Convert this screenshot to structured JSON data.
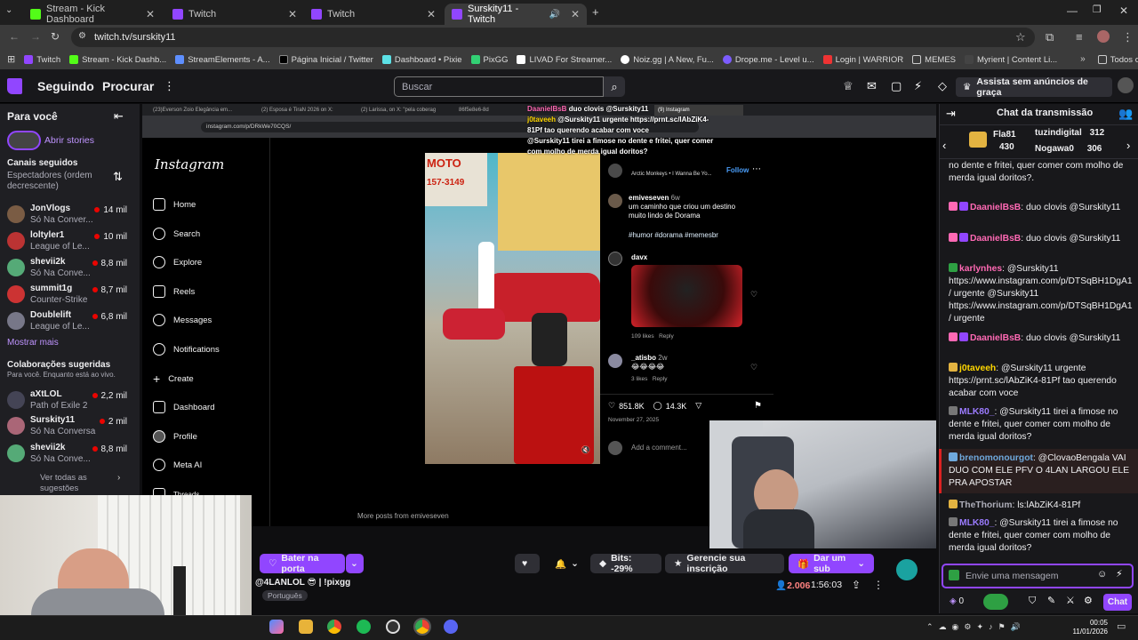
{
  "browser": {
    "tabs": [
      {
        "label": "Stream - Kick Dashboard",
        "color": "#53fc18"
      },
      {
        "label": "Twitch",
        "color": "#9146ff"
      },
      {
        "label": "Twitch",
        "color": "#9146ff"
      },
      {
        "label": "Surskity11 - Twitch",
        "color": "#9146ff"
      }
    ],
    "url": "twitch.tv/surskity11",
    "bookmarks": [
      "Twitch",
      "Stream - Kick Dashb...",
      "StreamElements - A...",
      "Página Inicial / Twitter",
      "Dashboard • Pixie",
      "PixGG",
      "LIVAD For Streamer...",
      "Noiz.gg | A New, Fu...",
      "Drope.me - Level u...",
      "Login | WARRIOR",
      "MEMES",
      "Myrient | Content Li..."
    ],
    "all_favorites": "Todos os favoritos"
  },
  "twitch": {
    "nav_following": "Seguindo",
    "nav_browse": "Procurar",
    "search_placeholder": "Buscar",
    "prime_label": "Assista sem anúncios de graça",
    "sidebar": {
      "for_you": "Para você",
      "stories": "Abrir stories",
      "followed_title": "Canais seguidos",
      "followed_sort": "Espectadores (ordem decrescente)",
      "channels": [
        {
          "name": "JonVlogs",
          "game": "Só Na Conver...",
          "viewers": "14 mil",
          "color": "#7a5c44"
        },
        {
          "name": "loltyler1",
          "game": "League of Le...",
          "viewers": "10 mil",
          "color": "#b33"
        },
        {
          "name": "shevii2k",
          "game": "Só Na Conve...",
          "viewers": "8,8 mil",
          "color": "#5a7"
        },
        {
          "name": "summit1g",
          "game": "Counter-Strike",
          "viewers": "8,7 mil",
          "color": "#c33"
        },
        {
          "name": "Doublelift",
          "game": "League of Le...",
          "viewers": "6,8 mil",
          "color": "#778"
        }
      ],
      "show_more": "Mostrar mais",
      "suggested_title": "Colaborações sugeridas",
      "suggested_sub": "Para você. Enquanto está ao vivo.",
      "suggested": [
        {
          "name": "aXtLOL",
          "game": "Path of Exile 2",
          "viewers": "2,2 mil",
          "color": "#445"
        },
        {
          "name": "Surskity11",
          "game": "Só Na Conversa",
          "viewers": "2 mil",
          "color": "#a67"
        },
        {
          "name": "shevii2k",
          "game": "Só Na Conve...",
          "viewers": "8,8 mil",
          "color": "#5a7"
        }
      ],
      "see_all": "Ver todas as sugestões"
    },
    "player": {
      "follow_label": "Bater na porta",
      "bits_label": "Bits: -29%",
      "manage_sub": "Gerencie sua inscrição",
      "gift_sub": "Dar um sub",
      "title_line": "@4LANLOL 😎 | !pixgg",
      "language": "Português",
      "viewers": "2.006",
      "uptime": "1:56:03"
    },
    "chat": {
      "title": "Chat da transmissão",
      "leaders": [
        {
          "name": "Fla81",
          "value": "430"
        },
        {
          "name": "tuzindigital",
          "value": "312"
        },
        {
          "name": "Nogawa0",
          "value": "306"
        }
      ],
      "messages": [
        {
          "user": "",
          "text": "no dente e fritei, quer comer com molho de merda igual doritos?.",
          "color": "#bf94ff"
        },
        {
          "user": "DaanielBsB",
          "text": "duo clovis @Surskity11",
          "color": "#ff69b4"
        },
        {
          "user": "DaanielBsB",
          "text": "duo clovis @Surskity11",
          "color": "#ff69b4"
        },
        {
          "user": "karlynhes",
          "text": "@Surskity11 https://www.instagram.com/p/DTSqBH1DgA1 / urgente @Surskity11 https://www.instagram.com/p/DTSqBH1DgA1 / urgente",
          "color": "#ff69b4"
        },
        {
          "user": "DaanielBsB",
          "text": "duo clovis @Surskity11",
          "color": "#ff69b4"
        },
        {
          "user": "j0taveeh",
          "text": "@Surskity11 urgente https://prnt.sc/lAbZiK4-81Pf tao querendo acabar com voce",
          "color": "#ffd700"
        },
        {
          "user": "MLK80_",
          "text": "@Surskity11 tirei a fimose no dente e fritei, quer comer com molho de merda igual doritos?",
          "color": "#9b7bff"
        },
        {
          "user": "brenomonourgot",
          "text": "@ClovaoBengala VAI DUO COM ELE PFV O 4LAN LARGOU ELE PRA APOSTAR",
          "color": "#6fa8dc"
        },
        {
          "user": "TheThorium",
          "text": "ls:lAbZiK4-81Pf",
          "color": "#adadb8"
        },
        {
          "user": "MLK80_",
          "text": "@Surskity11 tirei a fimose no dente e fritei, quer comer com molho de merda igual doritos?",
          "color": "#9b7bff"
        }
      ],
      "input_placeholder": "Envie uma mensagem",
      "points": "0",
      "chat_btn": "Chat"
    }
  },
  "instagram": {
    "url": "instagram.com/p/DRkWe70CQS/",
    "logo": "Instagram",
    "menu": [
      "Home",
      "Search",
      "Explore",
      "Reels",
      "Messages",
      "Notifications",
      "Create",
      "Dashboard",
      "Profile",
      "Meta AI",
      "Threads"
    ],
    "follow": "Follow",
    "song": "Arctic Monkeys • I Wanna Be Yo...",
    "caption_user": "emiveseven",
    "caption_age": "6w",
    "caption_text": "um caminho que criou um destino muito lindo de Dorama",
    "hashtags": "#humor #dorama #memesbr",
    "comment_user": "davx",
    "comment_likes": "109 likes",
    "reply": "Reply",
    "comment2_user": "_atisbo",
    "comment2_age": "2w",
    "comment2_likes": "3 likes",
    "likes": "851.8K",
    "comments": "14.3K",
    "date": "November 27, 2025",
    "add_comment": "Add a comment...",
    "more_posts": "More posts from emiveseven",
    "sign_text": "MOTO",
    "sign_phone": "157-3149",
    "overlay_user": "DaanielBsB",
    "overlay1": "duo clovis @Surskity11",
    "overlay_user2": "j0taveeh",
    "overlay2": "@Surskity11 urgente https://prnt.sc/lAbZiK4-81Pf tao querendo acabar com voce",
    "overlay3": "@Surskity11 tirei a fimose no dente e fritei, quer comer com molho de merda igual doritos?",
    "tabs": [
      "(23)Everson Zoio Elegância em...",
      "(2) Esposa é TiraN 2026 on X:",
      "(2) Larissa, on X: \"pela coberag",
      "86f5e8e6-8d",
      "(9) Instagram"
    ]
  },
  "taskbar": {
    "time": "00:05",
    "date": "11/01/2026"
  }
}
